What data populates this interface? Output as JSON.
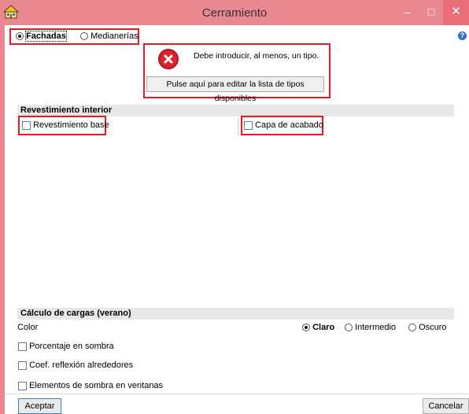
{
  "window": {
    "title": "Cerramiento",
    "minimize": "–",
    "maximize": "□",
    "close": "✕"
  },
  "type_selector": {
    "options": [
      "Fachadas",
      "Medianerías"
    ],
    "selected": "Fachadas"
  },
  "help": "?",
  "message": {
    "text": "Debe introducir, al menos, un tipo.",
    "edit_button": "Pulse aquí para editar la lista de tipos disponibles"
  },
  "revestimiento": {
    "title": "Revestimiento interior",
    "base_label": "Revestimiento base",
    "acabado_label": "Capa de acabado"
  },
  "cargas": {
    "title": "Cálculo de cargas (verano)",
    "color_label": "Color",
    "color_options": [
      "Claro",
      "Intermedio",
      "Oscuro"
    ],
    "color_selected": "Claro",
    "sombra_label": "Porcentaje en sombra",
    "coef_label": "Coef. reflexión alrededores",
    "elementos_label": "Elementos de sombra en ventanas"
  },
  "buttons": {
    "accept": "Aceptar",
    "cancel": "Cancelar"
  },
  "colors": {
    "title_bar": "#ea8892",
    "highlight_border": "#e51a22",
    "error_red": "#d9232d"
  }
}
